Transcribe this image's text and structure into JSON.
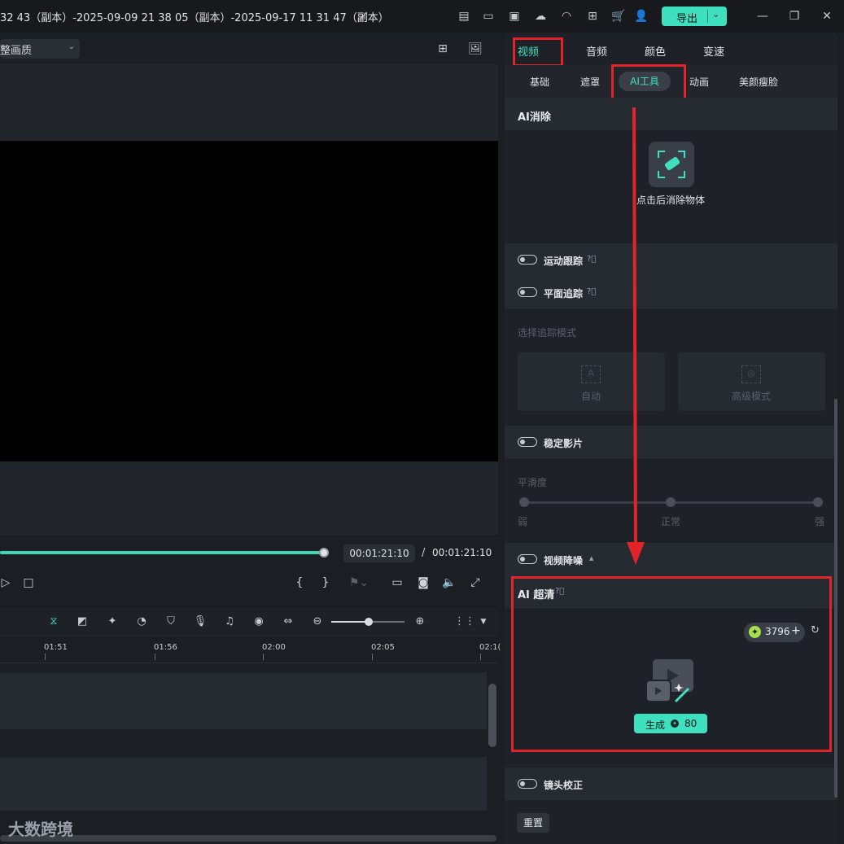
{
  "window": {
    "title": "32 43（副本）-2025-09-09 21 38 05（副本）-2025-09-17 11 31 47（副本）",
    "export_label": "导出"
  },
  "player": {
    "quality_label": "整画质",
    "current_time": "00:01:21:10",
    "separator": "/",
    "total_time": "00:01:21:10",
    "progress_percent": 65
  },
  "timeline": {
    "ruler_ticks": [
      "01:51",
      "01:56",
      "02:00",
      "02:05",
      "02:1("
    ],
    "zoom_percent": 50
  },
  "watermark": "大数跨境",
  "panel": {
    "tabs": [
      "视频",
      "音频",
      "颜色",
      "变速"
    ],
    "active_tab": "视频",
    "subtabs": [
      "基础",
      "遮罩",
      "AI工具",
      "动画",
      "美颜瘦脸"
    ],
    "active_subtab": "AI工具",
    "ai_erase": {
      "title": "AI消除",
      "button_label": "点击后消除物体"
    },
    "motion_tracking": {
      "label": "运动跟踪"
    },
    "plane_tracking": {
      "label": "平面追踪"
    },
    "tracking_mode": {
      "title": "选择追踪模式",
      "auto_label": "自动",
      "advanced_label": "高级模式"
    },
    "stabilize": {
      "label": "稳定影片"
    },
    "smoothness": {
      "title": "平滑度",
      "low": "弱",
      "mid": "正常",
      "high": "强"
    },
    "denoise": {
      "label": "视频降噪"
    },
    "ai_upscale": {
      "title": "AI 超清",
      "credits": "3796",
      "generate_label": "生成",
      "generate_cost": "80"
    },
    "lens_correction": {
      "label": "镜头校正"
    },
    "reset_label": "重置"
  },
  "colors": {
    "accent": "#3fe0c0",
    "highlight_box": "#e0242a",
    "arrow": "#e0242a"
  }
}
